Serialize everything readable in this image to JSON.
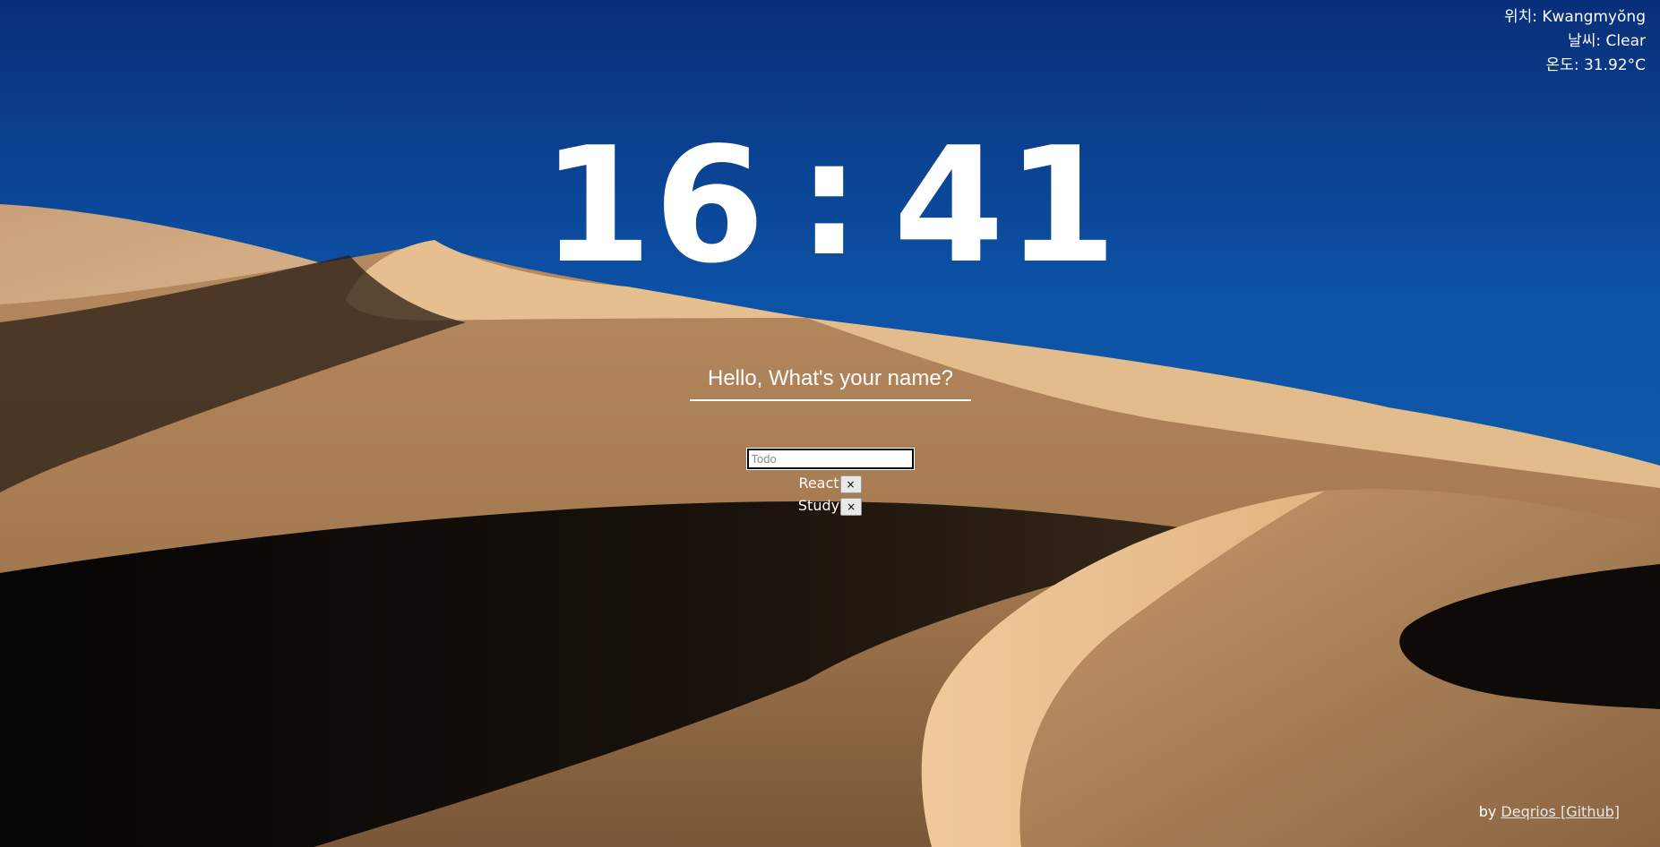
{
  "weather": {
    "location": "위치: Kwangmyŏng",
    "condition": "날씨: Clear",
    "temperature": "온도: 31.92°C"
  },
  "clock": {
    "hours": "16",
    "separator": ":",
    "minutes": "41"
  },
  "greeting": {
    "placeholder": "Hello, What's your name?"
  },
  "todo": {
    "placeholder": "Todo",
    "items": [
      {
        "text": "React",
        "delete_label": "×"
      },
      {
        "text": "Study",
        "delete_label": "×"
      }
    ]
  },
  "footer": {
    "prefix": "by",
    "link_text": "Deqrios [Github]"
  },
  "colors": {
    "sky_top": "#0a3f8f",
    "sand_light": "#e2b98a",
    "sand_mid": "#b88a5c",
    "shadow": "#0d0a08"
  },
  "background": {
    "description_icon": "desert-dunes-image"
  }
}
